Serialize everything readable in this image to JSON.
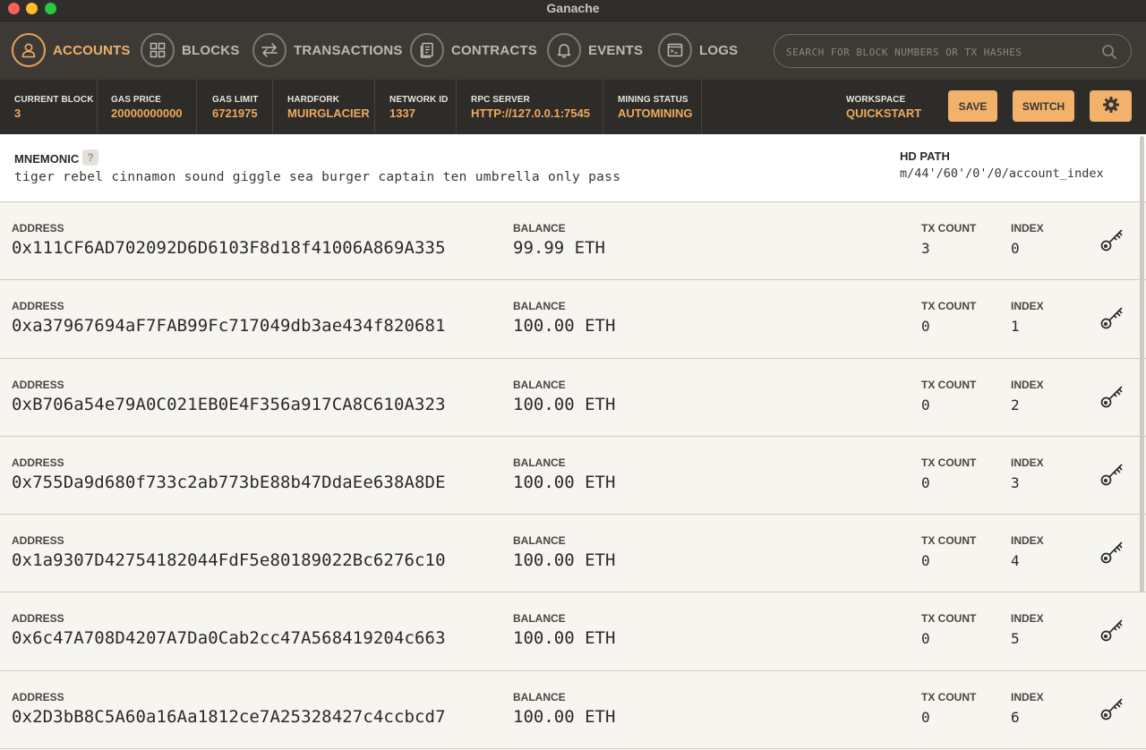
{
  "window": {
    "title": "Ganache"
  },
  "nav": {
    "items": [
      {
        "label": "ACCOUNTS",
        "icon": "account-icon",
        "active": true
      },
      {
        "label": "BLOCKS",
        "icon": "blocks-icon",
        "active": false
      },
      {
        "label": "TRANSACTIONS",
        "icon": "transactions-icon",
        "active": false
      },
      {
        "label": "CONTRACTS",
        "icon": "contracts-icon",
        "active": false
      },
      {
        "label": "EVENTS",
        "icon": "bell-icon",
        "active": false
      },
      {
        "label": "LOGS",
        "icon": "logs-icon",
        "active": false
      }
    ],
    "search_placeholder": "SEARCH FOR BLOCK NUMBERS OR TX HASHES"
  },
  "status": {
    "current_block": {
      "label": "CURRENT BLOCK",
      "value": "3"
    },
    "gas_price": {
      "label": "GAS PRICE",
      "value": "20000000000"
    },
    "gas_limit": {
      "label": "GAS LIMIT",
      "value": "6721975"
    },
    "hardfork": {
      "label": "HARDFORK",
      "value": "MUIRGLACIER"
    },
    "network_id": {
      "label": "NETWORK ID",
      "value": "1337"
    },
    "rpc_server": {
      "label": "RPC SERVER",
      "value": "HTTP://127.0.0.1:7545"
    },
    "mining_status": {
      "label": "MINING STATUS",
      "value": "AUTOMINING"
    },
    "workspace": {
      "label": "WORKSPACE",
      "value": "QUICKSTART"
    },
    "save_label": "SAVE",
    "switch_label": "SWITCH"
  },
  "mnemonic": {
    "label": "MNEMONIC",
    "help": "?",
    "words": "tiger rebel cinnamon sound giggle sea burger captain ten umbrella only pass",
    "hd_path_label": "HD PATH",
    "hd_path": "m/44'/60'/0'/0/account_index"
  },
  "labels": {
    "address": "ADDRESS",
    "balance": "BALANCE",
    "tx_count": "TX COUNT",
    "index": "INDEX"
  },
  "accounts": [
    {
      "address": "0x111CF6AD702092D6D6103F8d18f41006A869A335",
      "balance": "99.99 ETH",
      "tx_count": "3",
      "index": "0"
    },
    {
      "address": "0xa37967694aF7FAB99Fc717049db3ae434f820681",
      "balance": "100.00 ETH",
      "tx_count": "0",
      "index": "1"
    },
    {
      "address": "0xB706a54e79A0C021EB0E4F356a917CA8C610A323",
      "balance": "100.00 ETH",
      "tx_count": "0",
      "index": "2"
    },
    {
      "address": "0x755Da9d680f733c2ab773bE88b47DdaEe638A8DE",
      "balance": "100.00 ETH",
      "tx_count": "0",
      "index": "3"
    },
    {
      "address": "0x1a9307D42754182044FdF5e80189022Bc6276c10",
      "balance": "100.00 ETH",
      "tx_count": "0",
      "index": "4"
    },
    {
      "address": "0x6c47A708D4207A7Da0Cab2cc47A568419204c663",
      "balance": "100.00 ETH",
      "tx_count": "0",
      "index": "5"
    },
    {
      "address": "0x2D3bB8C5A60a16Aa1812ce7A25328427c4ccbcd7",
      "balance": "100.00 ETH",
      "tx_count": "0",
      "index": "6"
    }
  ],
  "colors": {
    "accent": "#efb06b",
    "nav_bg": "#3d3a36",
    "status_bg": "#2e2c29",
    "row_bg": "#f6f5f0"
  }
}
